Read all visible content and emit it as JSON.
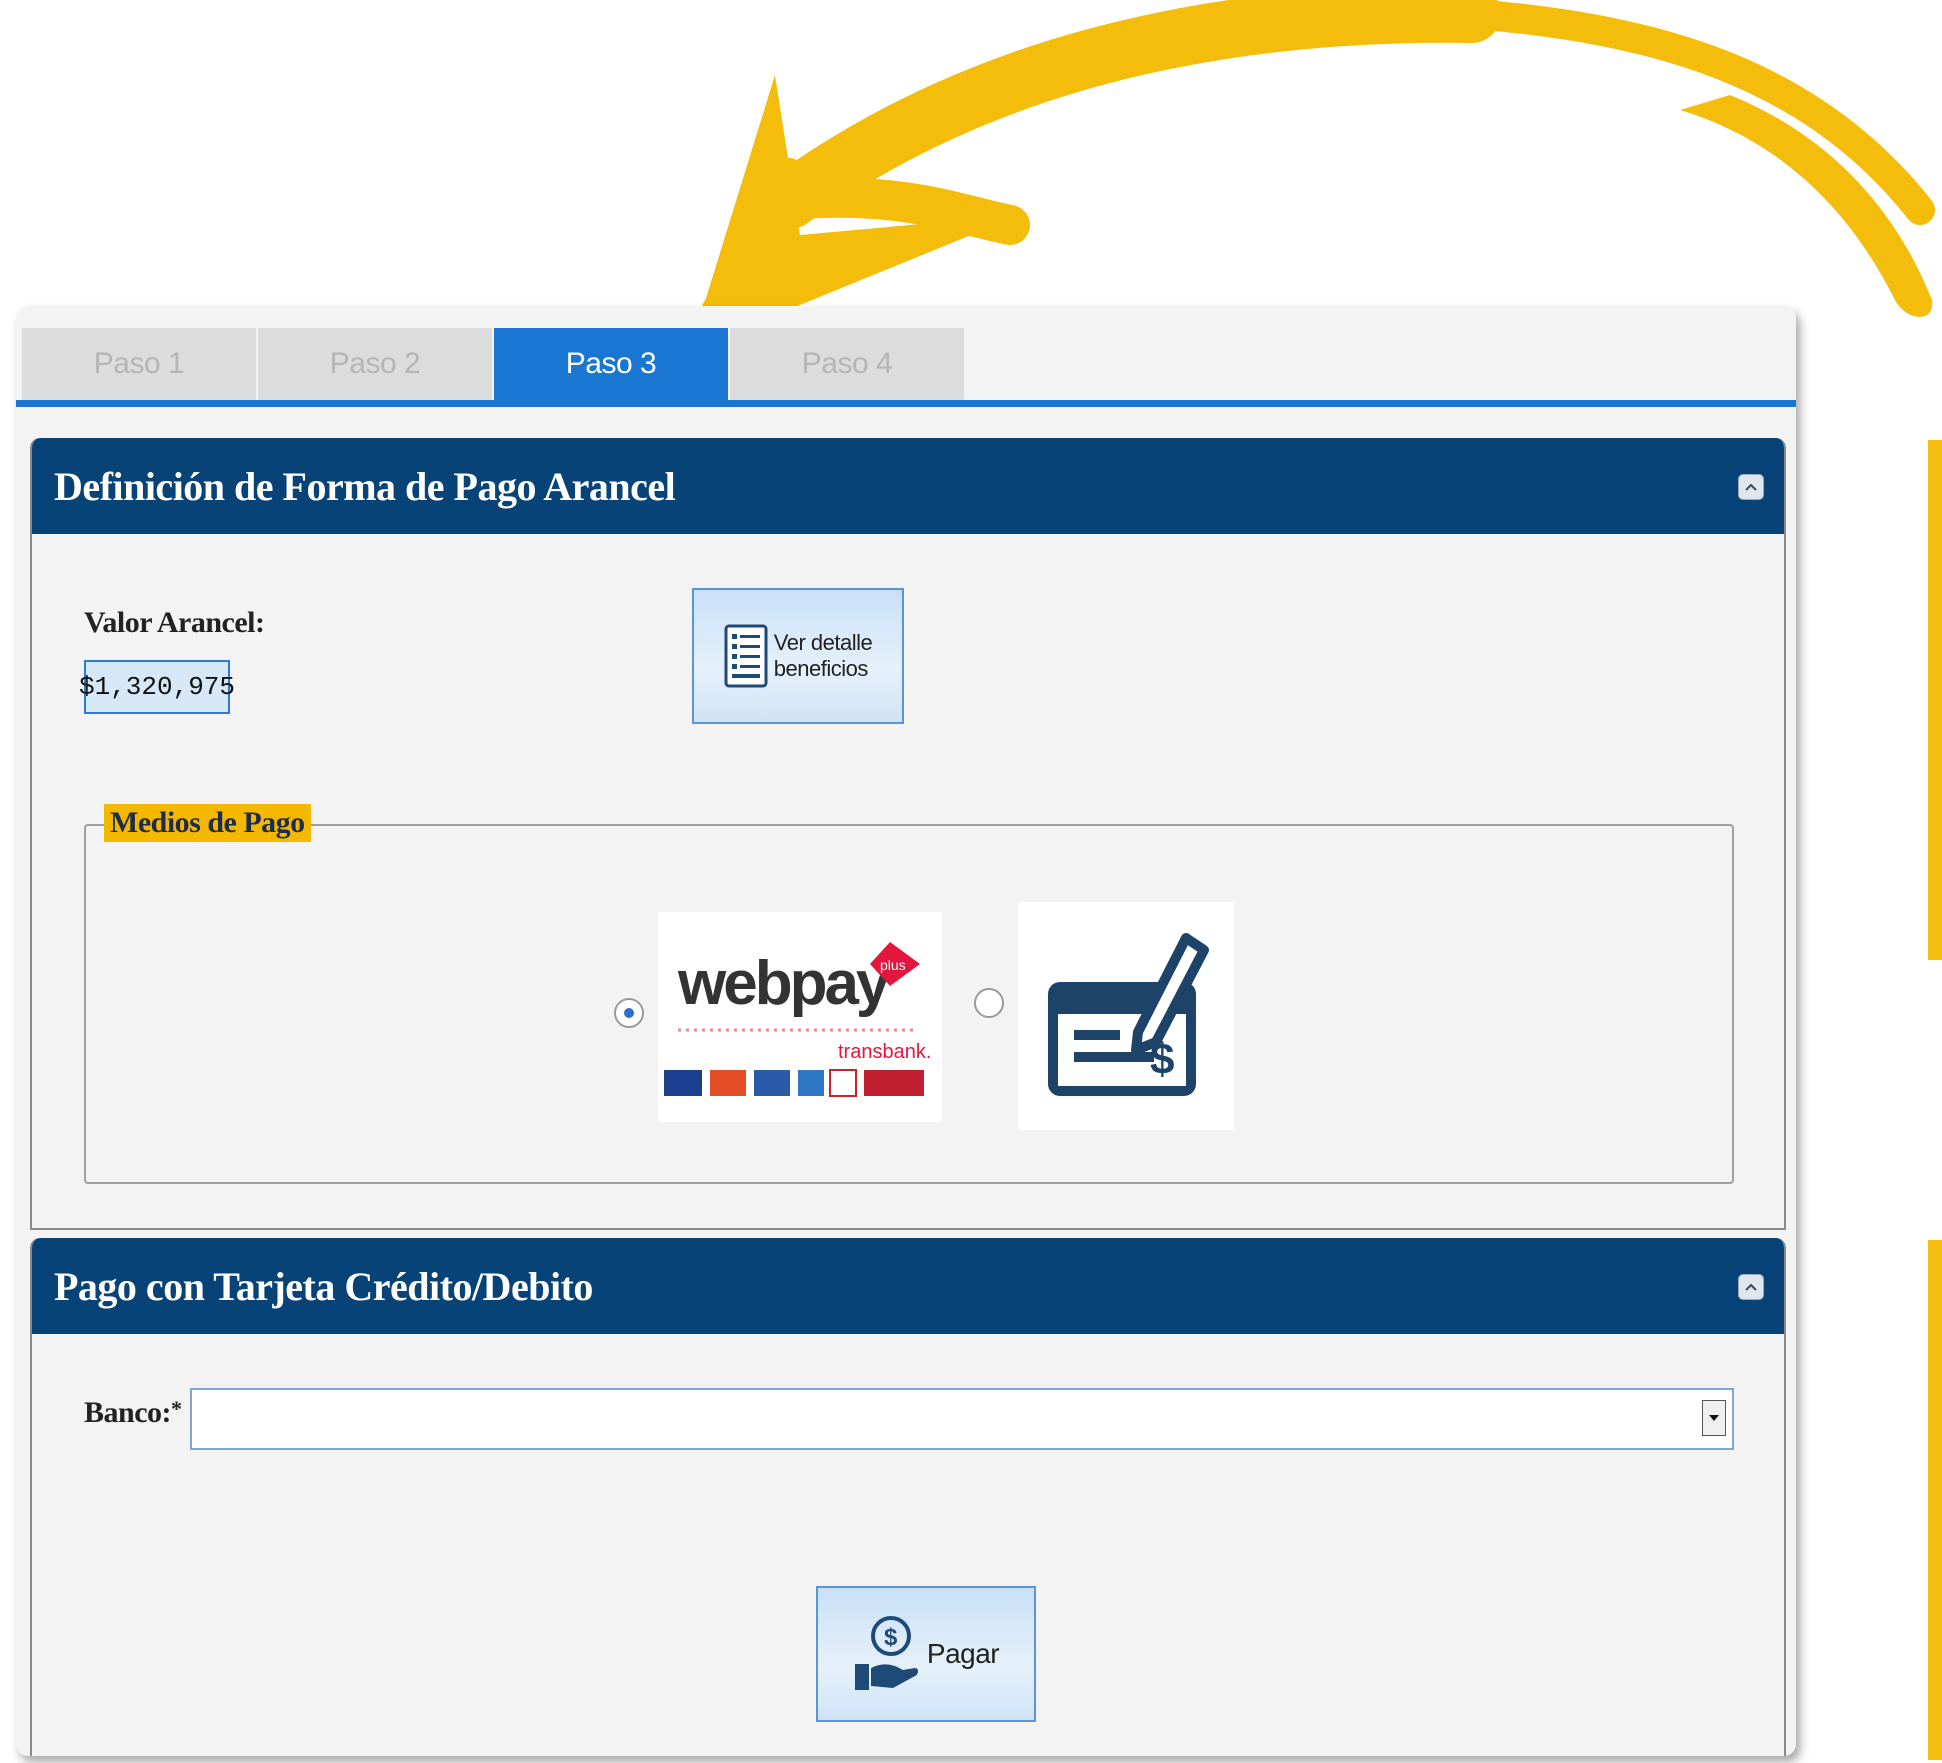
{
  "tabs": [
    {
      "label": "Paso 1"
    },
    {
      "label": "Paso 2"
    },
    {
      "label": "Paso 3"
    },
    {
      "label": "Paso 4"
    }
  ],
  "active_tab": "Paso 3",
  "colors": {
    "accent_blue": "#1976d2",
    "header_navy": "#084377",
    "legend_yellow": "#f5b800",
    "arrow_yellow": "#f4bd0b"
  },
  "panel1": {
    "title": "Definición de Forma de Pago Arancel",
    "valor_label": "Valor Arancel:",
    "valor_value": "$1,320,975",
    "detail_button_line1": "Ver detalle",
    "detail_button_line2": "beneficios",
    "medios_legend": "Medios de Pago",
    "options": [
      {
        "name": "webpay",
        "selected": true,
        "logo_text": "webpay",
        "logo_badge": "plus",
        "logo_sub": "transbank."
      },
      {
        "name": "cheque",
        "selected": false
      }
    ]
  },
  "panel2": {
    "title": "Pago con Tarjeta Crédito/Debito",
    "banco_label": "Banco:",
    "banco_required": "*",
    "banco_value": "",
    "pay_button": "Pagar"
  }
}
